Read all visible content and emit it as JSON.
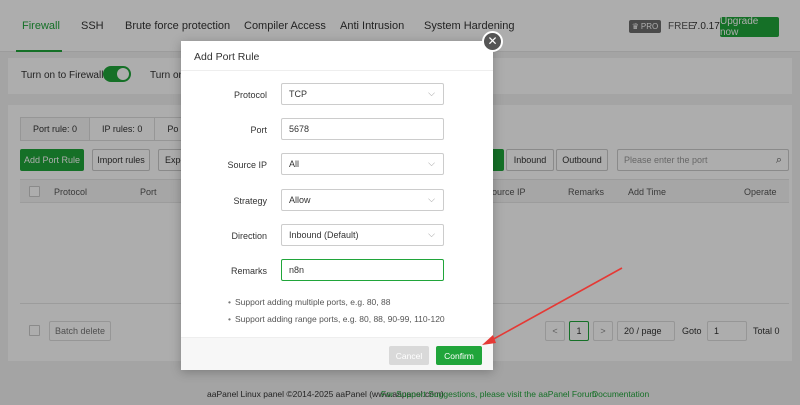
{
  "topnav": {
    "tabs": [
      "Firewall",
      "SSH",
      "Brute force protection",
      "Compiler Access",
      "Anti Intrusion",
      "System Hardening"
    ],
    "pro_label": "PRO",
    "free_label": "FREE",
    "version": "7.0.17",
    "upgrade_label": "Upgrade now"
  },
  "toggles": {
    "firewall_label": "Turn on to Firewall",
    "second_label": "Turn on t"
  },
  "panel": {
    "subtabs": [
      "Port rule: 0",
      "IP rules: 0",
      "Po"
    ],
    "add_button": "Add Port Rule",
    "import_button": "Import rules",
    "export_button": "Expo",
    "inbound_button": "Inbound",
    "outbound_button": "Outbound",
    "search_placeholder": "Please enter the port",
    "columns": {
      "protocol": "Protocol",
      "port": "Port",
      "source_ip": "Source IP",
      "remarks": "Remarks",
      "add_time": "Add Time",
      "operate": "Operate"
    },
    "batch_delete": "Batch delete",
    "pager": {
      "prev": "<",
      "current": "1",
      "next": ">",
      "page_size": "20 / page",
      "goto_label": "Goto",
      "goto_value": "1",
      "total": "Total 0"
    }
  },
  "footer": {
    "copyright": "aaPanel Linux panel ©2014-2025 aaPanel (www.aapanel.com)",
    "suggestions": "For Support Suggestions, please visit the aaPanel Forum",
    "documentation": "Documentation"
  },
  "modal": {
    "title": "Add Port Rule",
    "fields": {
      "protocol": {
        "label": "Protocol",
        "value": "TCP"
      },
      "port": {
        "label": "Port",
        "value": "5678"
      },
      "source_ip": {
        "label": "Source IP",
        "value": "All"
      },
      "strategy": {
        "label": "Strategy",
        "value": "Allow"
      },
      "direction": {
        "label": "Direction",
        "value": "Inbound (Default)"
      },
      "remarks": {
        "label": "Remarks",
        "value": "n8n"
      }
    },
    "hints": [
      "Support adding multiple ports, e.g. 80, 88",
      "Support adding range ports, e.g. 80, 88, 90-99, 110-120"
    ],
    "cancel_label": "Cancel",
    "confirm_label": "Confirm"
  },
  "colors": {
    "accent": "#20a53a",
    "annotation_arrow": "#e53935"
  }
}
